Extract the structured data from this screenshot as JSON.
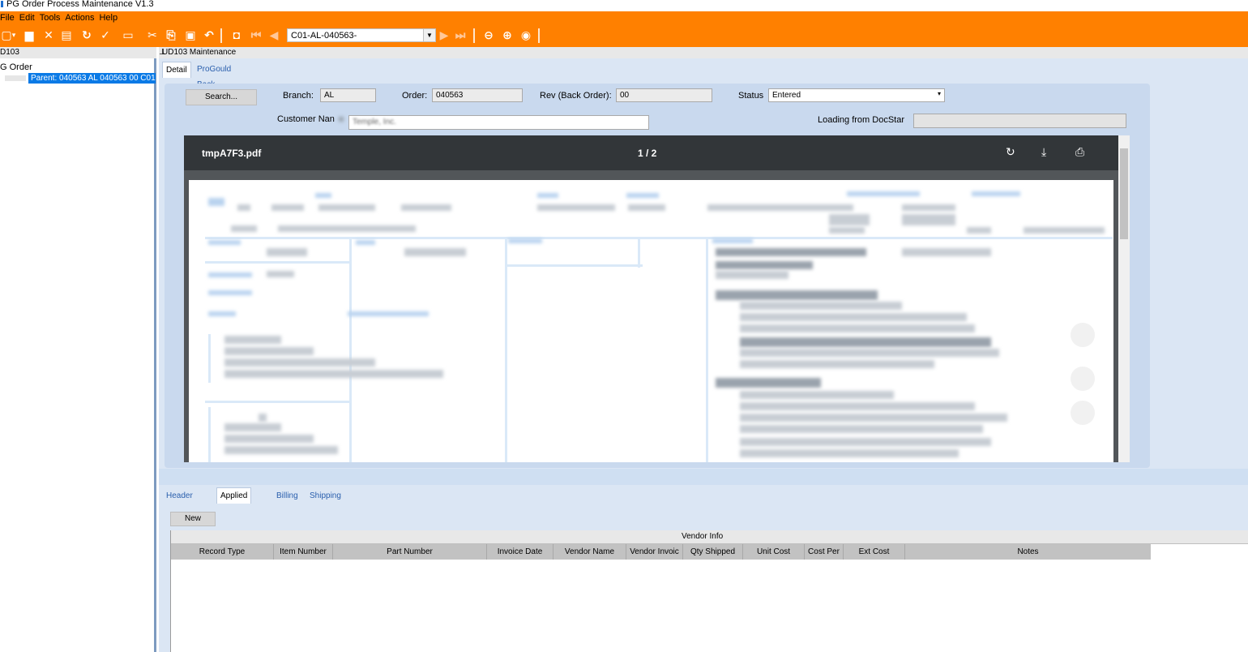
{
  "window": {
    "title": "PG Order Process Maintenance V1.3"
  },
  "menu": [
    "File",
    "Edit",
    "Tools",
    "Actions",
    "Help"
  ],
  "toolbar": {
    "key_value": "C01-AL-040563-"
  },
  "tree": {
    "header": "D103",
    "root": "G Order",
    "selected": "Parent: 040563 AL 040563 00 C01-"
  },
  "pane": {
    "title": "UD103 Maintenance"
  },
  "top_tabs": [
    "Detail",
    "ProGould Back Orders"
  ],
  "form": {
    "search_label": "Search...",
    "branch_label": "Branch:",
    "branch_value": "AL",
    "order_label": "Order:",
    "order_value": "040563",
    "rev_label": "Rev (Back Order):",
    "rev_value": "00",
    "status_label": "Status",
    "status_value": "Entered",
    "customer_label": "Customer Nan",
    "customer_value": "Temple, Inc.",
    "docstar_label": "Loading from DocStar",
    "docstar_value": ""
  },
  "pdf": {
    "filename": "tmpA7F3.pdf",
    "page": "1 / 2"
  },
  "bottom_tabs": [
    "Header Info",
    "Applied Cost",
    "Billing",
    "Shipping Breakdown"
  ],
  "grid": {
    "new_label": "New",
    "group_header": "Vendor Info",
    "columns": [
      "Record Type",
      "Item Number",
      "Part Number",
      "Invoice Date",
      "Vendor Name",
      "Vendor Invoic",
      "Qty Shipped",
      "Unit Cost",
      "Cost Per",
      "Ext Cost",
      "Notes"
    ]
  },
  "colors": {
    "accent": "#ff8000",
    "selection": "#0a7ae6",
    "panel": "#c9d9ee"
  }
}
